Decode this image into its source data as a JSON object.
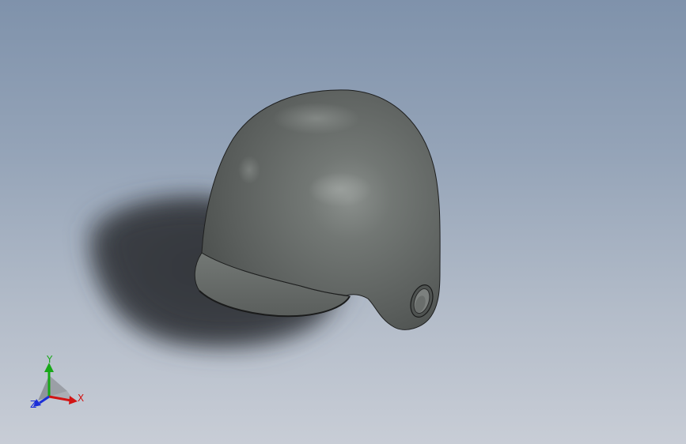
{
  "viewport": {
    "background_top": "#7f92ab",
    "background_bottom": "#c8cdd6",
    "model_color": "#5d615f",
    "shadow_color": "#3a3d42"
  },
  "triad": {
    "x_label": "X",
    "y_label": "Y",
    "z_label": "Z",
    "x_color": "#d21414",
    "y_color": "#18a818",
    "z_color": "#1c2fd8"
  }
}
